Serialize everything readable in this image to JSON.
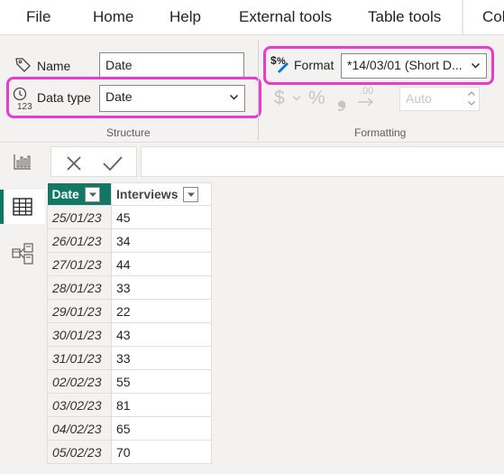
{
  "menu": {
    "tabs": [
      {
        "label": "File"
      },
      {
        "label": "Home"
      },
      {
        "label": "Help"
      },
      {
        "label": "External tools"
      },
      {
        "label": "Table tools"
      },
      {
        "label": "Col"
      }
    ],
    "active_tab": "Table tools"
  },
  "ribbon": {
    "structure": {
      "name_label": "Name",
      "name_value": "Date",
      "data_type_label": "Data type",
      "data_type_value": "Date",
      "group_label": "Structure"
    },
    "formatting": {
      "format_label": "Format",
      "format_value": "*14/03/01 (Short D...",
      "currency_symbol": "$",
      "percent_symbol": "%",
      "comma_symbol": "❟",
      "decimal_symbol": ".00",
      "decimal_places_value": "Auto",
      "group_label": "Formatting"
    },
    "highlight_color": "#e83ccf"
  },
  "formula_bar": {
    "cancel_icon": "close-icon",
    "commit_icon": "check-icon",
    "value": ""
  },
  "left_rail": {
    "items": [
      {
        "icon": "report-view-icon"
      },
      {
        "icon": "table-view-icon",
        "active": true
      },
      {
        "icon": "model-view-icon"
      }
    ],
    "accent": "#117865"
  },
  "table": {
    "columns": [
      "Date",
      "Interviews"
    ],
    "selected_column": "Date",
    "rows": [
      {
        "date": "25/01/23",
        "interviews": "45"
      },
      {
        "date": "26/01/23",
        "interviews": "34"
      },
      {
        "date": "27/01/23",
        "interviews": "44"
      },
      {
        "date": "28/01/23",
        "interviews": "33"
      },
      {
        "date": "29/01/23",
        "interviews": "22"
      },
      {
        "date": "30/01/23",
        "interviews": "43"
      },
      {
        "date": "31/01/23",
        "interviews": "33"
      },
      {
        "date": "02/02/23",
        "interviews": "55"
      },
      {
        "date": "03/02/23",
        "interviews": "81"
      },
      {
        "date": "04/02/23",
        "interviews": "65"
      },
      {
        "date": "05/02/23",
        "interviews": "70"
      }
    ]
  }
}
